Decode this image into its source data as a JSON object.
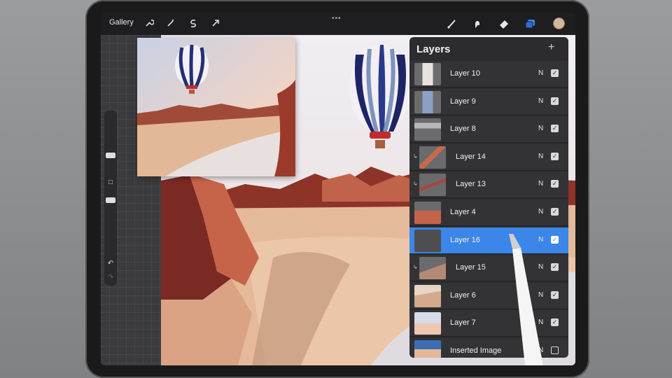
{
  "toolbar": {
    "gallery_label": "Gallery",
    "grip": "•••",
    "left_icons": [
      "wrench-icon",
      "magic-wand-icon",
      "selection-icon",
      "transform-arrow-icon"
    ],
    "right_icons": [
      "brush-icon",
      "smudge-icon",
      "eraser-icon",
      "layers-icon"
    ],
    "active_color": "#d7b59c"
  },
  "sidebar": {
    "undo_label": "↶",
    "redo_label": "↷",
    "modifier_label": "□"
  },
  "layers_panel": {
    "title": "Layers",
    "add_label": "+",
    "layers": [
      {
        "name": "Layer 10",
        "mode": "N",
        "visible": true,
        "clipped": false,
        "selected": false
      },
      {
        "name": "Layer 9",
        "mode": "N",
        "visible": true,
        "clipped": false,
        "selected": false
      },
      {
        "name": "Layer 8",
        "mode": "N",
        "visible": true,
        "clipped": false,
        "selected": false
      },
      {
        "name": "Layer 14",
        "mode": "N",
        "visible": true,
        "clipped": true,
        "selected": false
      },
      {
        "name": "Layer 13",
        "mode": "N",
        "visible": true,
        "clipped": true,
        "selected": false
      },
      {
        "name": "Layer 4",
        "mode": "N",
        "visible": true,
        "clipped": false,
        "selected": false
      },
      {
        "name": "Layer 16",
        "mode": "N",
        "visible": true,
        "clipped": false,
        "selected": true
      },
      {
        "name": "Layer 15",
        "mode": "N",
        "visible": true,
        "clipped": true,
        "selected": false
      },
      {
        "name": "Layer 6",
        "mode": "N",
        "visible": true,
        "clipped": false,
        "selected": false
      },
      {
        "name": "Layer 7",
        "mode": "N",
        "visible": true,
        "clipped": false,
        "selected": false
      },
      {
        "name": "Inserted Image",
        "mode": "N",
        "visible": false,
        "clipped": false,
        "selected": false
      }
    ]
  },
  "colors": {
    "accent": "#3b86e8",
    "sand": "#e7bfa0",
    "rock": "#b45a3e",
    "dark_rock": "#7a2a22",
    "sky": "#ece8ee"
  }
}
